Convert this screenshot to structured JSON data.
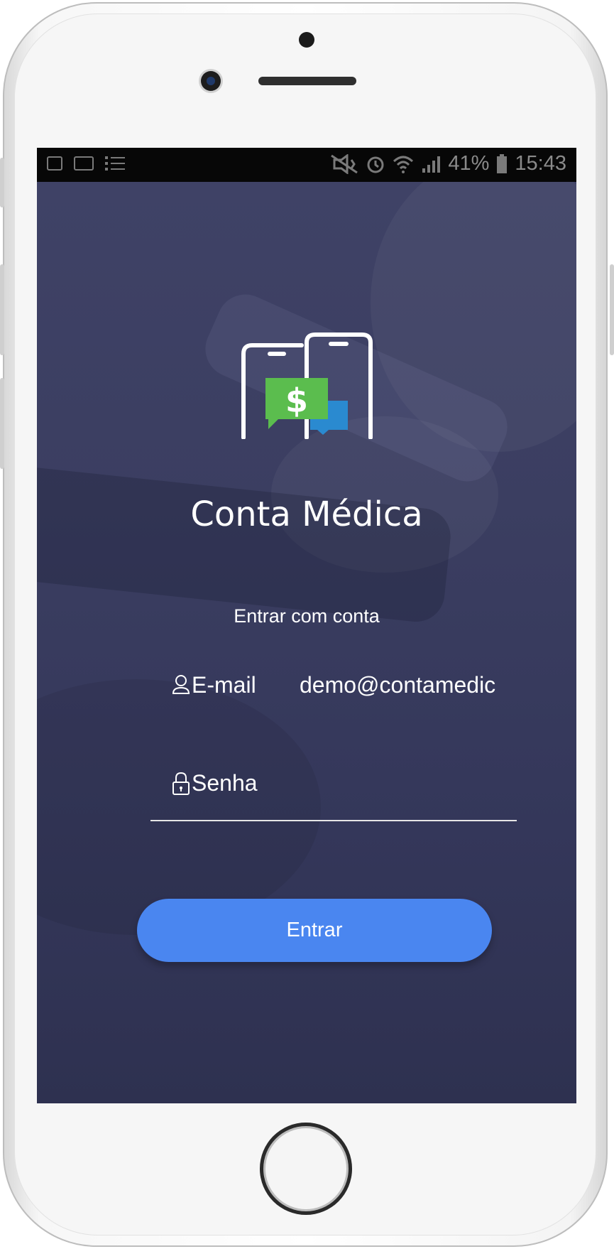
{
  "status_bar": {
    "battery_percent": "41%",
    "time": "15:43",
    "left_icons": [
      "image-icon",
      "voicemail-icon",
      "list-icon"
    ],
    "right_icons": [
      "mute-vibrate-icon",
      "alarm-icon",
      "wifi-icon",
      "signal-icon",
      "battery-icon"
    ]
  },
  "app": {
    "title": "Conta Médica",
    "subtitle": "Entrar com conta",
    "logo_icon": "phones-dollar-chat-logo",
    "colors": {
      "background": "#3b3e61",
      "button": "#4a86f0",
      "logo_green": "#5bbd4e",
      "logo_blue": "#2a8ad0"
    }
  },
  "form": {
    "email": {
      "label": "E-mail",
      "value": "demo@contamedic",
      "icon": "user-icon"
    },
    "password": {
      "label": "Senha",
      "value": "",
      "icon": "lock-icon"
    },
    "submit_label": "Entrar"
  }
}
